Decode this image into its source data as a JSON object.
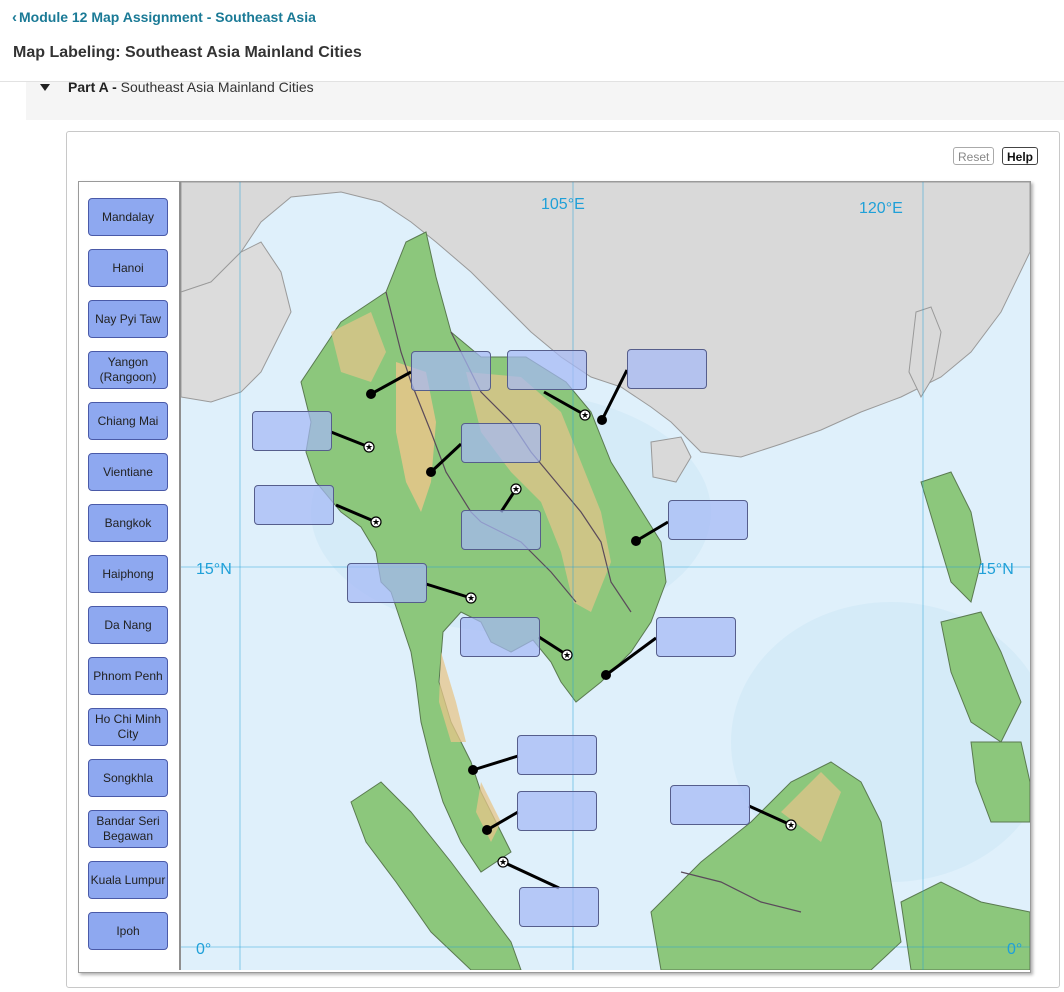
{
  "header": {
    "back_link": "Module 12 Map Assignment - Southeast Asia",
    "page_title": "Map Labeling: Southeast Asia Mainland Cities"
  },
  "part": {
    "prefix": "Part A -",
    "title": "Southeast Asia Mainland Cities"
  },
  "toolbar": {
    "reset_label": "Reset",
    "help_label": "Help"
  },
  "labels": [
    "Mandalay",
    "Hanoi",
    "Nay Pyi Taw",
    "Yangon (Rangoon)",
    "Chiang Mai",
    "Vientiane",
    "Bangkok",
    "Haiphong",
    "Da Nang",
    "Phnom Penh",
    "Ho Chi Minh City",
    "Songkhla",
    "Bandar Seri Begawan",
    "Kuala Lumpur",
    "Ipoh"
  ],
  "map": {
    "longitudes": [
      "105°E",
      "120°E"
    ],
    "latitudes": [
      "15°N",
      "0°"
    ],
    "drop_target_count": 15,
    "colors": {
      "sea": "#dff0fb",
      "land_foreign": "#d8d8d8",
      "lowland": "#8cc77c",
      "highland": "#e7c58a",
      "graticule": "#1fa0d8",
      "drop_target": "#a5b9f5",
      "label_chip": "#8ea8f0"
    }
  }
}
